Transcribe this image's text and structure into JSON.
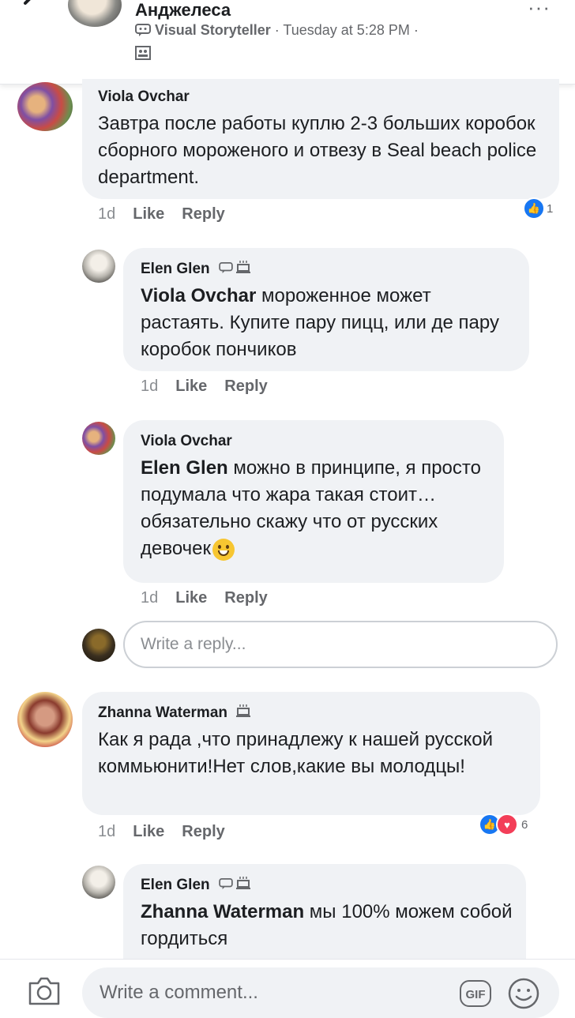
{
  "header": {
    "author_name": "Анджелеса",
    "author_badge": "Visual Storyteller",
    "timestamp": " · Tuesday at 5:28 PM ·",
    "more_label": "···"
  },
  "comments": [
    {
      "author": "Viola Ovchar",
      "text": "Завтра после работы куплю 2-3 больших коробок сборного мороженого и отвезу в Seal beach police department.",
      "time": "1d",
      "like": "Like",
      "reply": "Reply",
      "reaction_count": "1"
    },
    {
      "author": "Elen Glen",
      "mention": "Viola Ovchar",
      "text": " мороженное может растаять. Купите пару пицц, или де пару коробок пончиков",
      "time": "1d",
      "like": "Like",
      "reply": "Reply"
    },
    {
      "author": "Viola Ovchar",
      "mention": "Elen Glen",
      "text": " можно в принципе, я просто подумала что жара такая стоит…обязательно скажу что от русских девочек",
      "time": "1d",
      "like": "Like",
      "reply": "Reply"
    },
    {
      "author": "Zhanna Waterman",
      "text": "Как я рада ,что принадлежу к нашей русской коммьюнити!Нет слов,какие вы молодцы!",
      "time": "1d",
      "like": "Like",
      "reply": "Reply",
      "reaction_count": "6"
    },
    {
      "author": "Elen Glen",
      "mention": "Zhanna Waterman",
      "text": " мы 100% можем собой гордиться"
    }
  ],
  "reply_input": {
    "placeholder": "Write a reply..."
  },
  "footer": {
    "placeholder": "Write a comment...",
    "gif_label": "GIF"
  },
  "colors": {
    "like_blue": "#1877f2",
    "love_red": "#f33e58",
    "bubble_bg": "#f0f2f5"
  }
}
